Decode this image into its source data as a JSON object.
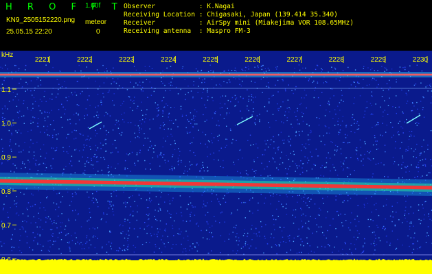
{
  "header": {
    "title": "H R O F F T",
    "version": "1.00f",
    "filename": "KN9_2505152220.png",
    "datetime": "25.05.15 22:20",
    "meteor_label": "meteor",
    "meteor_count": "0",
    "observer": "Observer           : K.Nagai",
    "location": "Receiving Location : Chigasaki, Japan (139.414 35.340)",
    "receiver": "Receiver           : AirSpy mini (Miakejima VOR 108.65MHz)",
    "antenna": "Receiving antenna  : Maspro FM-3"
  },
  "plot": {
    "unit": "kHz",
    "time_ticks": [
      "2221",
      "2222",
      "2223",
      "2224",
      "2225",
      "2226",
      "2227",
      "2228",
      "2229",
      "2230"
    ],
    "freq_ticks": [
      "1.1",
      "1.0",
      "0.9",
      "0.8",
      "0.7",
      "0.6"
    ],
    "colors": {
      "background": "#0a1a8c",
      "noise": "#2f4cff",
      "band": "#ff3030",
      "baseline": "#ffff00",
      "text": "#ffff00",
      "meteor": "#7fffff"
    }
  }
}
